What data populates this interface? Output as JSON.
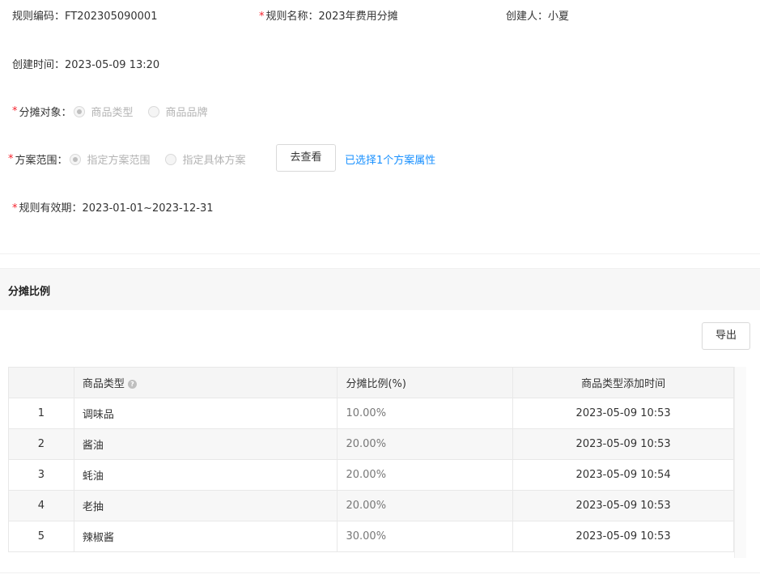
{
  "form": {
    "rule_code_label": "规则编码",
    "rule_code_value": "FT202305090001",
    "rule_name_label": "规则名称",
    "rule_name_value": "2023年费用分摊",
    "creator_label": "创建人",
    "creator_value": "小夏",
    "created_time_label": "创建时间",
    "created_time_value": "2023-05-09 13:20",
    "allocation_target_label": "分摊对象",
    "allocation_target_options": [
      "商品类型",
      "商品品牌"
    ],
    "allocation_target_selected": "商品类型",
    "plan_scope_label": "方案范围",
    "plan_scope_options": [
      "指定方案范围",
      "指定具体方案"
    ],
    "plan_scope_selected": "指定方案范围",
    "view_button_label": "去查看",
    "selected_link": "已选择1个方案属性",
    "validity_label": "规则有效期",
    "validity_value": "2023-01-01~2023-12-31",
    "colon": "："
  },
  "section": {
    "title": "分摊比例",
    "export_button_label": "导出"
  },
  "table": {
    "headers": [
      "",
      "商品类型",
      "分摊比例(%)",
      "商品类型添加时间"
    ],
    "rows": [
      {
        "idx": "1",
        "name": "调味品",
        "ratio": "10.00%",
        "time": "2023-05-09 10:53"
      },
      {
        "idx": "2",
        "name": "酱油",
        "ratio": "20.00%",
        "time": "2023-05-09 10:53"
      },
      {
        "idx": "3",
        "name": "蚝油",
        "ratio": "20.00%",
        "time": "2023-05-09 10:54"
      },
      {
        "idx": "4",
        "name": "老抽",
        "ratio": "20.00%",
        "time": "2023-05-09 10:53"
      },
      {
        "idx": "5",
        "name": "辣椒酱",
        "ratio": "30.00%",
        "time": "2023-05-09 10:53"
      }
    ]
  },
  "colors": {
    "required": "#f5222d",
    "link": "#1890ff",
    "header_bg": "#f7f7f7"
  },
  "icons": {
    "help": "question-circle-icon"
  }
}
